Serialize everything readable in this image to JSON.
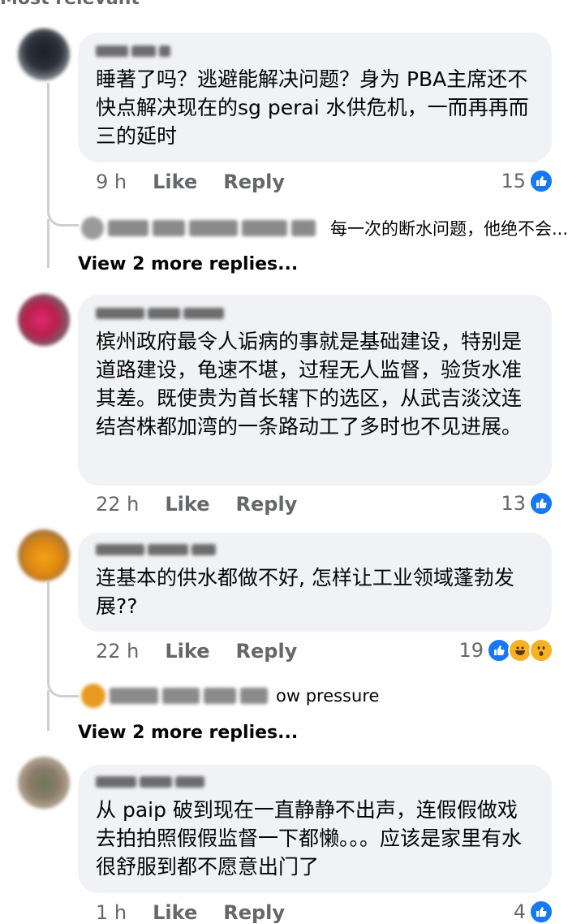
{
  "header": {
    "label": "Most relevant"
  },
  "comments": [
    {
      "text": "睡著了吗？逃避能解决问题？身为 PBA主席还不快点解决现在的sg perai 水供危机，一而再再而三的延时",
      "time": "9 h",
      "like_label": "Like",
      "reply_label": "Reply",
      "reaction_count": "15",
      "reply_preview": "每一次的断水问题，他绝不会...",
      "view_more": "View 2 more replies..."
    },
    {
      "text": "槟州政府最令人诟病的事就是基础建设，特别是道路建设，龟速不堪，过程无人监督，验货水准其差。既使贵为首长辖下的选区，从武吉淡汶连结峇株都加湾的一条路动工了多时也不见进展。",
      "time": "22 h",
      "like_label": "Like",
      "reply_label": "Reply",
      "reaction_count": "13"
    },
    {
      "text": "连基本的供水都做不好, 怎样让工业领域蓬勃发展??",
      "time": "22 h",
      "like_label": "Like",
      "reply_label": "Reply",
      "reaction_count": "19",
      "reply_preview": "ow pressure",
      "view_more": "View 2 more replies..."
    },
    {
      "text": "从 paip 破到现在一直静静不出声，连假假做戏去拍拍照假假监督一下都懒。。。应该是家里有水很舒服到都不愿意出门了",
      "time": "1 h",
      "like_label": "Like",
      "reply_label": "Reply",
      "reaction_count": "4"
    }
  ],
  "colors": {
    "like_blue": "#1877f2",
    "bubble_bg": "#f0f2f5",
    "meta_gray": "#65676b"
  },
  "icons": {
    "like": "like-reaction-icon",
    "haha": "haha-reaction-icon",
    "wow": "wow-reaction-icon"
  }
}
